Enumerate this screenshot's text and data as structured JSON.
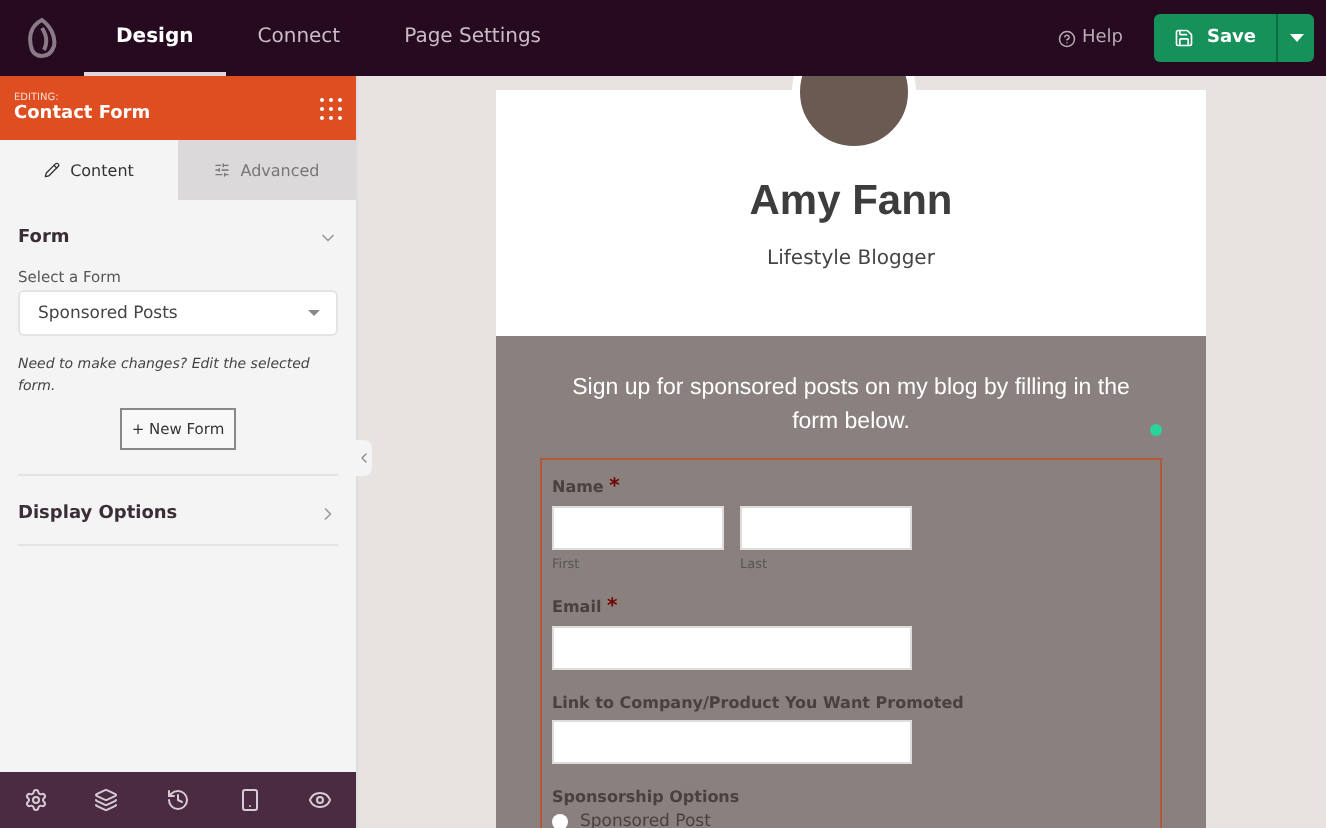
{
  "top_tabs": [
    {
      "label": "Design",
      "selected": true
    },
    {
      "label": "Connect",
      "selected": false
    },
    {
      "label": "Page Settings",
      "selected": false
    }
  ],
  "help": "Help",
  "save": "Save",
  "editing": {
    "caption": "EDITING:",
    "title": "Contact Form"
  },
  "panel_tabs": [
    {
      "label": "Content",
      "selected": true,
      "kind": "pencil"
    },
    {
      "label": "Advanced",
      "selected": false,
      "kind": "sliders"
    }
  ],
  "form_section": {
    "title": "Form",
    "expanded": true,
    "select_label": "Select a Form",
    "select_value": "Sponsored Posts",
    "hint": "Need to make changes? Edit the selected form.",
    "new_button": "+ New Form"
  },
  "display_section": {
    "title": "Display Options",
    "expanded": false
  },
  "toolbar": [
    {
      "kind": "settings"
    },
    {
      "kind": "layers"
    },
    {
      "kind": "history"
    },
    {
      "kind": "mobile"
    },
    {
      "kind": "preview"
    }
  ],
  "profile": {
    "name": "Amy Fann",
    "subtitle": "Lifestyle Blogger"
  },
  "intro": "Sign up for sponsored posts on my blog by filling in the form below.",
  "fields": [
    {
      "kind": "name",
      "label": "Name",
      "mark": "*",
      "sublabels": [
        "First",
        "Last"
      ]
    },
    {
      "kind": "text",
      "label": "Email",
      "mark": "*"
    },
    {
      "kind": "text",
      "label": "Link to Company/Product You Want Promoted"
    },
    {
      "kind": "radio",
      "label": "Sponsorship Options",
      "options": [
        {
          "label": "Sponsored Post",
          "selected": false
        }
      ]
    }
  ]
}
